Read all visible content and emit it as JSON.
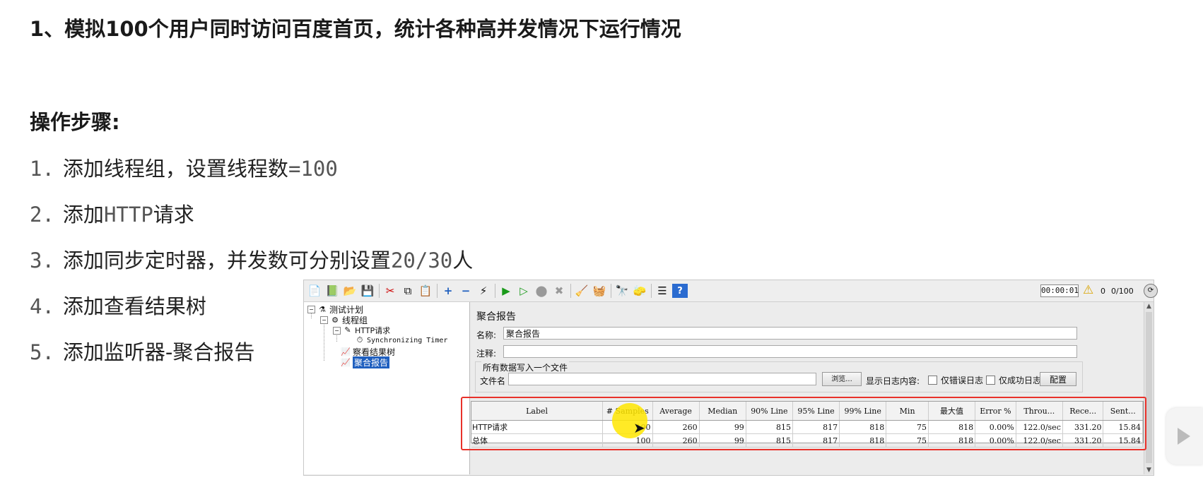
{
  "slide": {
    "title": "1、模拟100个用户同时访问百度首页，统计各种高并发情况下运行情况",
    "steps_heading": "操作步骤:",
    "steps": [
      {
        "num": "1.",
        "text": "添加线程组，设置线程数",
        "suffix": "=100"
      },
      {
        "num": "2.",
        "text": "添加",
        "suffix": "HTTP",
        "tail": "请求"
      },
      {
        "num": "3.",
        "text": "添加同步定时器，并发数可分别设置",
        "suffix": "20/30",
        "tail": "人"
      },
      {
        "num": "4.",
        "text": "添加查看结果树"
      },
      {
        "num": "5.",
        "text": "添加监听器-聚合报告"
      }
    ]
  },
  "jmeter": {
    "toolbar": {
      "elapsed_time": "00:00:01",
      "warning_count": "0",
      "thread_count": "0/100"
    },
    "tree": {
      "test_plan": "测试计划",
      "thread_group": "线程组",
      "http_request": "HTTP请求",
      "sync_timer": "Synchronizing Timer",
      "view_results_tree": "察看结果树",
      "aggregate_report": "聚合报告"
    },
    "panel": {
      "title": "聚合报告",
      "name_label": "名称:",
      "name_value": "聚合报告",
      "comment_label": "注释:",
      "comment_value": "",
      "group_title": "所有数据写入一个文件",
      "filename_label": "文件名",
      "filename_value": "",
      "browse_button": "浏览...",
      "log_display_label": "显示日志内容:",
      "errors_only_label": "仅错误日志",
      "success_only_label": "仅成功日志",
      "configure_button": "配置"
    },
    "table": {
      "headers": [
        "Label",
        "# Samples",
        "Average",
        "Median",
        "90% Line",
        "95% Line",
        "99% Line",
        "Min",
        "最大值",
        "Error %",
        "Throu...",
        "Rece...",
        "Sent..."
      ],
      "rows": [
        [
          "HTTP请求",
          "100",
          "260",
          "99",
          "815",
          "817",
          "818",
          "75",
          "818",
          "0.00%",
          "122.0/sec",
          "331.20",
          "15.84"
        ],
        [
          "总体",
          "100",
          "260",
          "99",
          "815",
          "817",
          "818",
          "75",
          "818",
          "0.00%",
          "122.0/sec",
          "331.20",
          "15.84"
        ]
      ]
    }
  },
  "colors": {
    "highlight_border": "#e8312a",
    "cursor_glow": "#ffe600",
    "tree_selection": "#1f5fbf"
  }
}
